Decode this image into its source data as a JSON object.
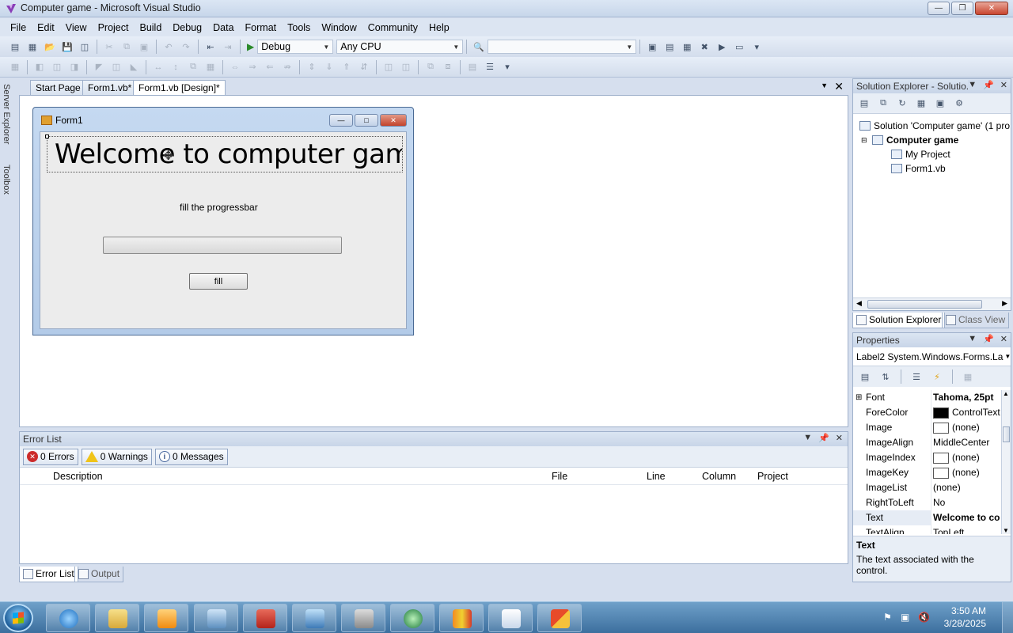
{
  "window": {
    "title": "Computer game - Microsoft Visual Studio"
  },
  "menu": [
    "File",
    "Edit",
    "View",
    "Project",
    "Build",
    "Debug",
    "Data",
    "Format",
    "Tools",
    "Window",
    "Community",
    "Help"
  ],
  "toolbar": {
    "config": "Debug",
    "platform": "Any CPU",
    "find": ""
  },
  "side_tabs": {
    "server_explorer": "Server Explorer",
    "toolbox": "Toolbox"
  },
  "doc_tabs": [
    "Start Page",
    "Form1.vb*",
    "Form1.vb [Design]*"
  ],
  "form": {
    "title": "Form1",
    "welcome_label": "Welcome to computer game",
    "fill_label": "fill the progressbar",
    "progress_fraction": 0,
    "button_label": "fill"
  },
  "error_list": {
    "title": "Error List",
    "errors": "0 Errors",
    "warnings": "0 Warnings",
    "messages": "0 Messages",
    "columns": [
      "Description",
      "File",
      "Line",
      "Column",
      "Project"
    ]
  },
  "bottom_tabs": [
    "Error List",
    "Output"
  ],
  "solution_explorer": {
    "title": "Solution Explorer - Solutio...",
    "solution": "Solution 'Computer game' (1 pro",
    "project": "Computer game",
    "my_project": "My Project",
    "form_file": "Form1.vb",
    "tabs": [
      "Solution Explorer",
      "Class View"
    ]
  },
  "properties": {
    "title": "Properties",
    "object": "Label2 System.Windows.Forms.La",
    "rows": [
      {
        "name": "Font",
        "value": "Tahoma, 25pt"
      },
      {
        "name": "ForeColor",
        "value": "ControlText"
      },
      {
        "name": "Image",
        "value": "(none)"
      },
      {
        "name": "ImageAlign",
        "value": "MiddleCenter"
      },
      {
        "name": "ImageIndex",
        "value": "(none)"
      },
      {
        "name": "ImageKey",
        "value": "(none)"
      },
      {
        "name": "ImageList",
        "value": "(none)"
      },
      {
        "name": "RightToLeft",
        "value": "No"
      },
      {
        "name": "Text",
        "value": "Welcome to co"
      },
      {
        "name": "TextAlign",
        "value": "TopLeft"
      }
    ],
    "desc_title": "Text",
    "desc_text": "The text associated with the control."
  },
  "taskbar": {
    "time": "3:50 AM",
    "date": "3/28/2025"
  },
  "colors": {
    "titlebar": "#c7d6ea",
    "taskbar": "#3c6f9e",
    "close_button": "#c9452f"
  }
}
